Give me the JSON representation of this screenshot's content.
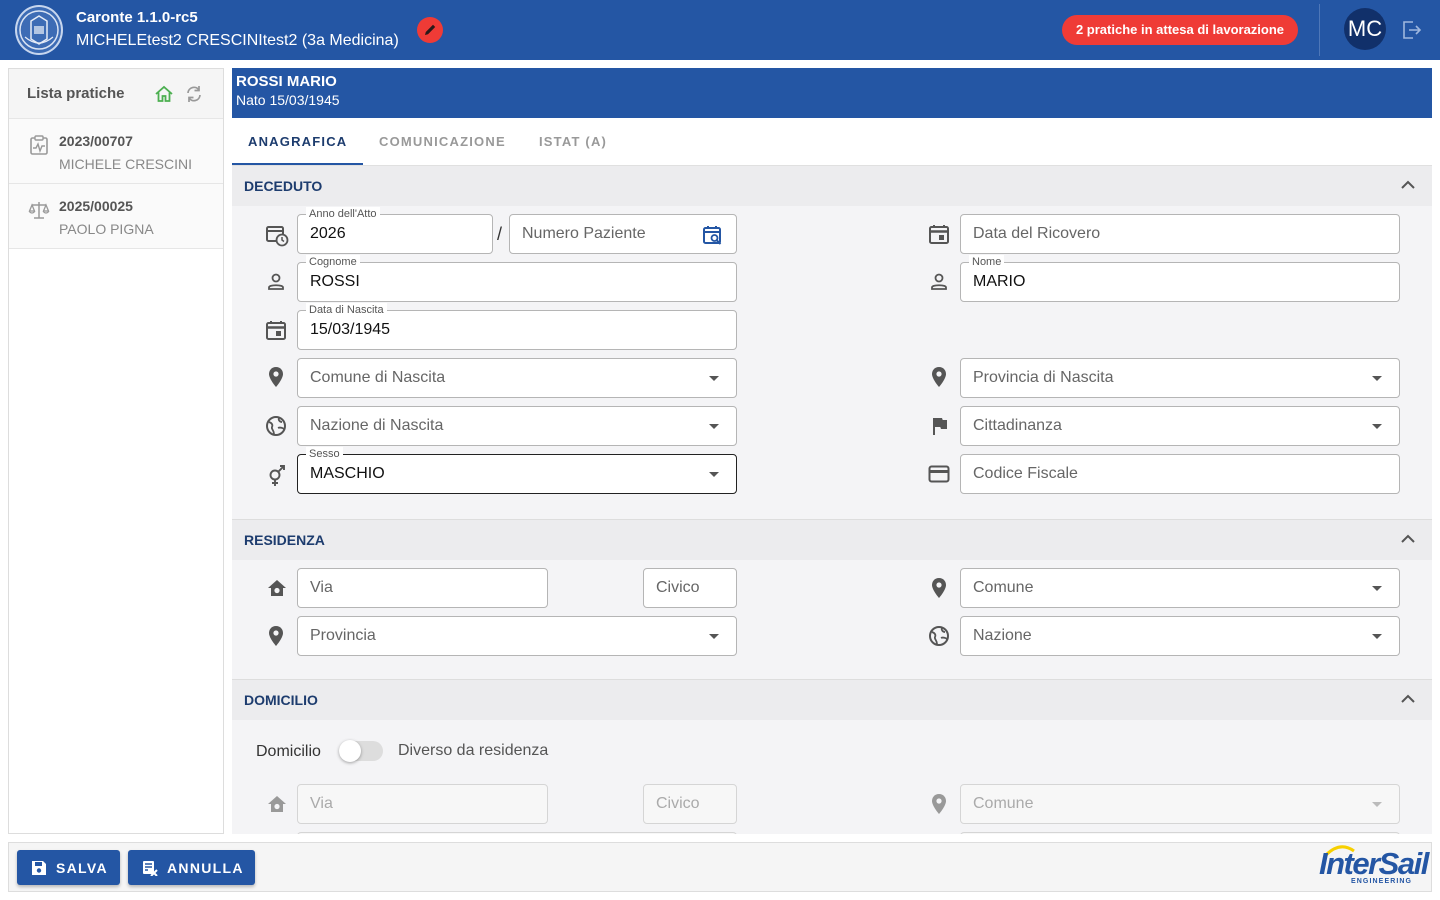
{
  "header": {
    "app_title": "Caronte 1.1.0-rc5",
    "user_line": "MICHELEtest2 CRESCINItest2 (3a Medicina)",
    "pending_badge": "2 pratiche in attesa di lavorazione",
    "avatar_initials": "MC"
  },
  "sidebar": {
    "title": "Lista pratiche",
    "items": [
      {
        "number": "2023/00707",
        "name": "MICHELE CRESCINI",
        "icon": "medical-clipboard-icon"
      },
      {
        "number": "2025/00025",
        "name": "PAOLO PIGNA",
        "icon": "scales-icon"
      }
    ]
  },
  "patient": {
    "name": "ROSSI MARIO",
    "birth_line": "Nato 15/03/1945"
  },
  "tabs": [
    {
      "label": "ANAGRAFICA",
      "active": true
    },
    {
      "label": "COMUNICAZIONE",
      "active": false
    },
    {
      "label": "ISTAT (A)",
      "active": false
    }
  ],
  "deceduto": {
    "title": "DECEDUTO",
    "anno_label": "Anno dell'Atto",
    "anno_value": "2026",
    "separator": "/",
    "numero_placeholder": "Numero Paziente",
    "ricovero_placeholder": "Data del Ricovero",
    "cognome_label": "Cognome",
    "cognome_value": "ROSSI",
    "nome_label": "Nome",
    "nome_value": "MARIO",
    "nascita_label": "Data di Nascita",
    "nascita_value": "15/03/1945",
    "comune_placeholder": "Comune di Nascita",
    "provincia_placeholder": "Provincia di Nascita",
    "nazione_placeholder": "Nazione di Nascita",
    "cittadinanza_placeholder": "Cittadinanza",
    "sesso_label": "Sesso",
    "sesso_value": "MASCHIO",
    "cf_placeholder": "Codice Fiscale"
  },
  "residenza": {
    "title": "RESIDENZA",
    "via_placeholder": "Via",
    "civico_placeholder": "Civico",
    "comune_placeholder": "Comune",
    "provincia_placeholder": "Provincia",
    "nazione_placeholder": "Nazione"
  },
  "domicilio": {
    "title": "DOMICILIO",
    "toggle_label": "Domicilio",
    "toggle_text": "Diverso da residenza",
    "toggle_on": false,
    "via_placeholder": "Via",
    "civico_placeholder": "Civico",
    "comune_placeholder": "Comune"
  },
  "footer": {
    "save_label": "SALVA",
    "cancel_label": "ANNULLA"
  },
  "brand": {
    "name": "InterSail",
    "sub": "ENGINEERING"
  },
  "colors": {
    "primary": "#2456a4",
    "badge": "#ef3b36",
    "section_title": "#1d3c6e",
    "home_icon": "#4caf50"
  }
}
